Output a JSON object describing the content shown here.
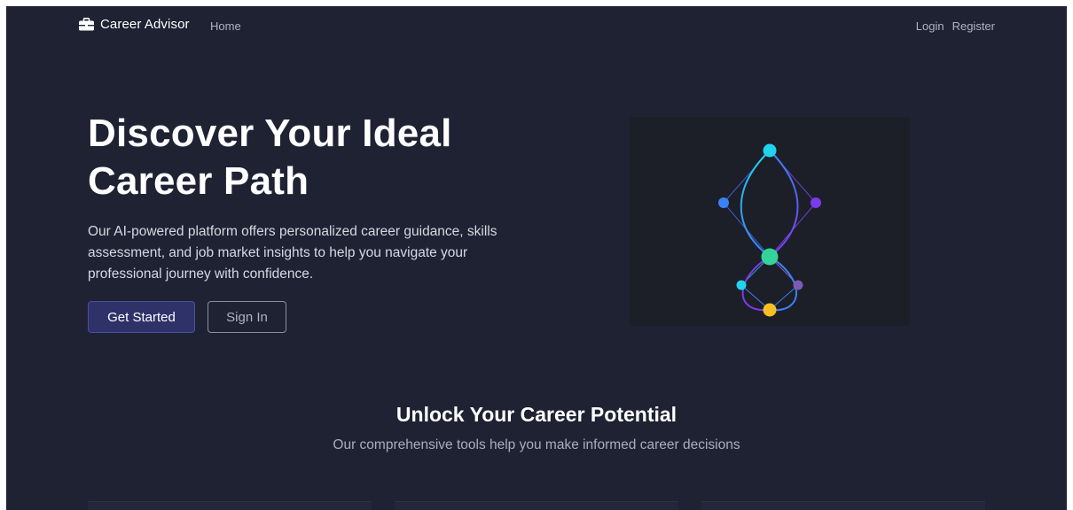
{
  "nav": {
    "brand": "Career Advisor",
    "home": "Home",
    "login": "Login",
    "register": "Register"
  },
  "hero": {
    "title": "Discover Your Ideal Career Path",
    "description": "Our AI-powered platform offers personalized career guidance, skills assessment, and job market insights to help you navigate your professional journey with confidence.",
    "primary_button": "Get Started",
    "secondary_button": "Sign In"
  },
  "features": {
    "title": "Unlock Your Career Potential",
    "subtitle": "Our comprehensive tools help you make informed career decisions"
  },
  "icons": {
    "brand": "briefcase-icon"
  },
  "colors": {
    "background": "#1e2233",
    "primary_button": "#2f3269",
    "node_cyan": "#22d3ee",
    "node_blue": "#3b82f6",
    "node_purple": "#7c3aed",
    "node_green": "#34d399",
    "node_yellow": "#fbbf24"
  }
}
